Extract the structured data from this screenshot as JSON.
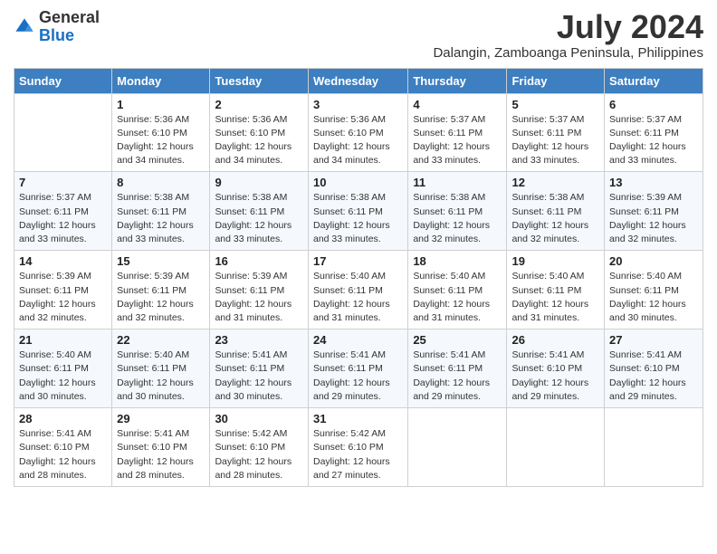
{
  "header": {
    "logo_general": "General",
    "logo_blue": "Blue",
    "month_year": "July 2024",
    "location": "Dalangin, Zamboanga Peninsula, Philippines"
  },
  "weekdays": [
    "Sunday",
    "Monday",
    "Tuesday",
    "Wednesday",
    "Thursday",
    "Friday",
    "Saturday"
  ],
  "weeks": [
    [
      {
        "day": "",
        "info": ""
      },
      {
        "day": "1",
        "info": "Sunrise: 5:36 AM\nSunset: 6:10 PM\nDaylight: 12 hours and 34 minutes."
      },
      {
        "day": "2",
        "info": "Sunrise: 5:36 AM\nSunset: 6:10 PM\nDaylight: 12 hours and 34 minutes."
      },
      {
        "day": "3",
        "info": "Sunrise: 5:36 AM\nSunset: 6:10 PM\nDaylight: 12 hours and 34 minutes."
      },
      {
        "day": "4",
        "info": "Sunrise: 5:37 AM\nSunset: 6:11 PM\nDaylight: 12 hours and 33 minutes."
      },
      {
        "day": "5",
        "info": "Sunrise: 5:37 AM\nSunset: 6:11 PM\nDaylight: 12 hours and 33 minutes."
      },
      {
        "day": "6",
        "info": "Sunrise: 5:37 AM\nSunset: 6:11 PM\nDaylight: 12 hours and 33 minutes."
      }
    ],
    [
      {
        "day": "7",
        "info": "Sunrise: 5:37 AM\nSunset: 6:11 PM\nDaylight: 12 hours and 33 minutes."
      },
      {
        "day": "8",
        "info": "Sunrise: 5:38 AM\nSunset: 6:11 PM\nDaylight: 12 hours and 33 minutes."
      },
      {
        "day": "9",
        "info": "Sunrise: 5:38 AM\nSunset: 6:11 PM\nDaylight: 12 hours and 33 minutes."
      },
      {
        "day": "10",
        "info": "Sunrise: 5:38 AM\nSunset: 6:11 PM\nDaylight: 12 hours and 33 minutes."
      },
      {
        "day": "11",
        "info": "Sunrise: 5:38 AM\nSunset: 6:11 PM\nDaylight: 12 hours and 32 minutes."
      },
      {
        "day": "12",
        "info": "Sunrise: 5:38 AM\nSunset: 6:11 PM\nDaylight: 12 hours and 32 minutes."
      },
      {
        "day": "13",
        "info": "Sunrise: 5:39 AM\nSunset: 6:11 PM\nDaylight: 12 hours and 32 minutes."
      }
    ],
    [
      {
        "day": "14",
        "info": "Sunrise: 5:39 AM\nSunset: 6:11 PM\nDaylight: 12 hours and 32 minutes."
      },
      {
        "day": "15",
        "info": "Sunrise: 5:39 AM\nSunset: 6:11 PM\nDaylight: 12 hours and 32 minutes."
      },
      {
        "day": "16",
        "info": "Sunrise: 5:39 AM\nSunset: 6:11 PM\nDaylight: 12 hours and 31 minutes."
      },
      {
        "day": "17",
        "info": "Sunrise: 5:40 AM\nSunset: 6:11 PM\nDaylight: 12 hours and 31 minutes."
      },
      {
        "day": "18",
        "info": "Sunrise: 5:40 AM\nSunset: 6:11 PM\nDaylight: 12 hours and 31 minutes."
      },
      {
        "day": "19",
        "info": "Sunrise: 5:40 AM\nSunset: 6:11 PM\nDaylight: 12 hours and 31 minutes."
      },
      {
        "day": "20",
        "info": "Sunrise: 5:40 AM\nSunset: 6:11 PM\nDaylight: 12 hours and 30 minutes."
      }
    ],
    [
      {
        "day": "21",
        "info": "Sunrise: 5:40 AM\nSunset: 6:11 PM\nDaylight: 12 hours and 30 minutes."
      },
      {
        "day": "22",
        "info": "Sunrise: 5:40 AM\nSunset: 6:11 PM\nDaylight: 12 hours and 30 minutes."
      },
      {
        "day": "23",
        "info": "Sunrise: 5:41 AM\nSunset: 6:11 PM\nDaylight: 12 hours and 30 minutes."
      },
      {
        "day": "24",
        "info": "Sunrise: 5:41 AM\nSunset: 6:11 PM\nDaylight: 12 hours and 29 minutes."
      },
      {
        "day": "25",
        "info": "Sunrise: 5:41 AM\nSunset: 6:11 PM\nDaylight: 12 hours and 29 minutes."
      },
      {
        "day": "26",
        "info": "Sunrise: 5:41 AM\nSunset: 6:10 PM\nDaylight: 12 hours and 29 minutes."
      },
      {
        "day": "27",
        "info": "Sunrise: 5:41 AM\nSunset: 6:10 PM\nDaylight: 12 hours and 29 minutes."
      }
    ],
    [
      {
        "day": "28",
        "info": "Sunrise: 5:41 AM\nSunset: 6:10 PM\nDaylight: 12 hours and 28 minutes."
      },
      {
        "day": "29",
        "info": "Sunrise: 5:41 AM\nSunset: 6:10 PM\nDaylight: 12 hours and 28 minutes."
      },
      {
        "day": "30",
        "info": "Sunrise: 5:42 AM\nSunset: 6:10 PM\nDaylight: 12 hours and 28 minutes."
      },
      {
        "day": "31",
        "info": "Sunrise: 5:42 AM\nSunset: 6:10 PM\nDaylight: 12 hours and 27 minutes."
      },
      {
        "day": "",
        "info": ""
      },
      {
        "day": "",
        "info": ""
      },
      {
        "day": "",
        "info": ""
      }
    ]
  ]
}
